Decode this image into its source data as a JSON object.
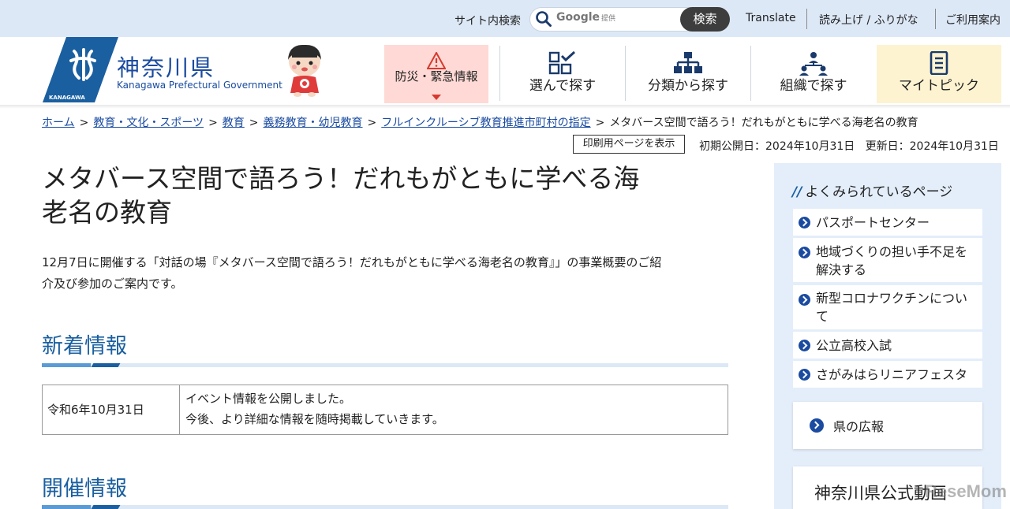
{
  "topbar": {
    "search_label": "サイト内検索",
    "search_placeholder_brand": "Google",
    "search_placeholder_suffix": "提供",
    "search_button": "検索",
    "links": [
      "Translate",
      "読み上げ / ふりがな",
      "ご利用案内"
    ]
  },
  "header": {
    "logo_title": "神奈川県",
    "logo_subtitle": "Kanagawa Prefectural Government",
    "logo_mark_text": "KANAGAWA",
    "nav": [
      {
        "label": "防災・緊急情報",
        "icon": "warning-icon"
      },
      {
        "label": "選んで探す",
        "icon": "grid-check-icon"
      },
      {
        "label": "分類から探す",
        "icon": "tree-icon"
      },
      {
        "label": "組織で探す",
        "icon": "org-icon"
      },
      {
        "label": "マイトピック",
        "icon": "notebook-icon"
      }
    ]
  },
  "breadcrumb": {
    "items": [
      "ホーム",
      "教育・文化・スポーツ",
      "教育",
      "義務教育・幼児教育",
      "フルインクルーシブ教育推進市町村の指定"
    ],
    "current": "メタバース空間で語ろう！だれもがともに学べる海老名の教育",
    "separator": ">"
  },
  "meta": {
    "print_button": "印刷用ページを表示",
    "published": "初期公開日：2024年10月31日",
    "updated": "更新日：2024年10月31日"
  },
  "main": {
    "title_line1": "メタバース空間で語ろう！だれもがともに学べる海",
    "title_line2": "老名の教育",
    "intro_line1": "12月7日に開催する「対話の場『メタバース空間で語ろう！だれもがともに学べる海老名の教育』」の事業概要のご紹",
    "intro_line2": "介及び参加のご案内です。",
    "section_news": "新着情報",
    "news": {
      "date": "令和6年10月31日",
      "line1": "イベント情報を公開しました。",
      "line2": "今後、より詳細な情報を随時掲載していきます。"
    },
    "section_event": "開催情報"
  },
  "sidebar": {
    "title": "よくみられているページ",
    "items": [
      {
        "line1": "パスポートセンター",
        "line2": ""
      },
      {
        "line1": "地域づくりの担い手不足を",
        "line2": "解決する"
      },
      {
        "line1": "新型コロナワクチンについ",
        "line2": "て"
      },
      {
        "line1": "公立高校入試",
        "line2": ""
      },
      {
        "line1": "さがみはらリニアフェスタ",
        "line2": ""
      }
    ],
    "card1": "県の広報",
    "card2": "神奈川県公式動画"
  },
  "watermark": "ReseMom",
  "colors": {
    "accent": "#1a4ba0",
    "topbar_bg": "#dde8f7",
    "disaster_bg": "#ffd9d5",
    "mytopic_bg": "#fdf3d1",
    "sidebar_bg": "#e4eefa"
  }
}
